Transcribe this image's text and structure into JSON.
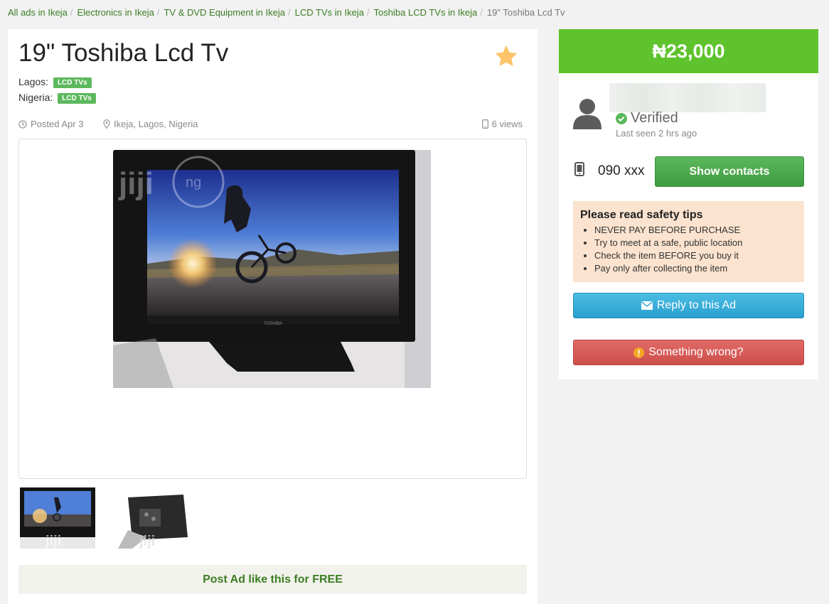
{
  "breadcrumb": {
    "items": [
      "All ads in Ikeja",
      "Electronics in Ikeja",
      "TV & DVD Equipment in Ikeja",
      "LCD TVs in Ikeja",
      "Toshiba LCD TVs in Ikeja"
    ],
    "current": "19\" Toshiba Lcd Tv",
    "separator": "/"
  },
  "ad": {
    "title": "19\" Toshiba Lcd Tv",
    "categories": [
      {
        "region": "Lagos:",
        "badge": "LCD TVs"
      },
      {
        "region": "Nigeria:",
        "badge": "LCD TVs"
      }
    ],
    "posted": "Posted Apr 3",
    "location": "Ikeja, Lagos, Nigeria",
    "views": "6 views",
    "tv_brand": "TOSHIBA",
    "watermark": "jiji",
    "watermark_suffix": "ng"
  },
  "post_free_label": "Post Ad like this for FREE",
  "sidebar": {
    "price": "₦23,000",
    "verified_label": "Verified",
    "last_seen": "Last seen 2 hrs ago",
    "phone": "090 xxx",
    "show_contacts_label": "Show contacts",
    "safety": {
      "title": "Please read safety tips",
      "tips": [
        "NEVER PAY BEFORE PURCHASE",
        "Try to meet at a safe, public location",
        "Check the item BEFORE you buy it",
        "Pay only after collecting the item"
      ]
    },
    "reply_label": "Reply to this Ad",
    "wrong_label": "Something wrong?"
  },
  "colors": {
    "price_bar": "#5ec32c",
    "link_green": "#3b7d23",
    "badge": "#5cb85c",
    "reply_button": "#2a9fd0",
    "wrong_button": "#cc4f4b",
    "star": "#fdc46b",
    "safety_bg": "#fbe3cf"
  },
  "icons": {
    "favorite": "star-icon",
    "posted": "clock-icon",
    "location": "map-pin-icon",
    "views": "mobile-icon",
    "avatar": "user-silhouette-icon",
    "verified": "check-circle-icon",
    "phone": "phone-icon",
    "reply": "envelope-icon",
    "wrong": "exclamation-circle-icon"
  }
}
